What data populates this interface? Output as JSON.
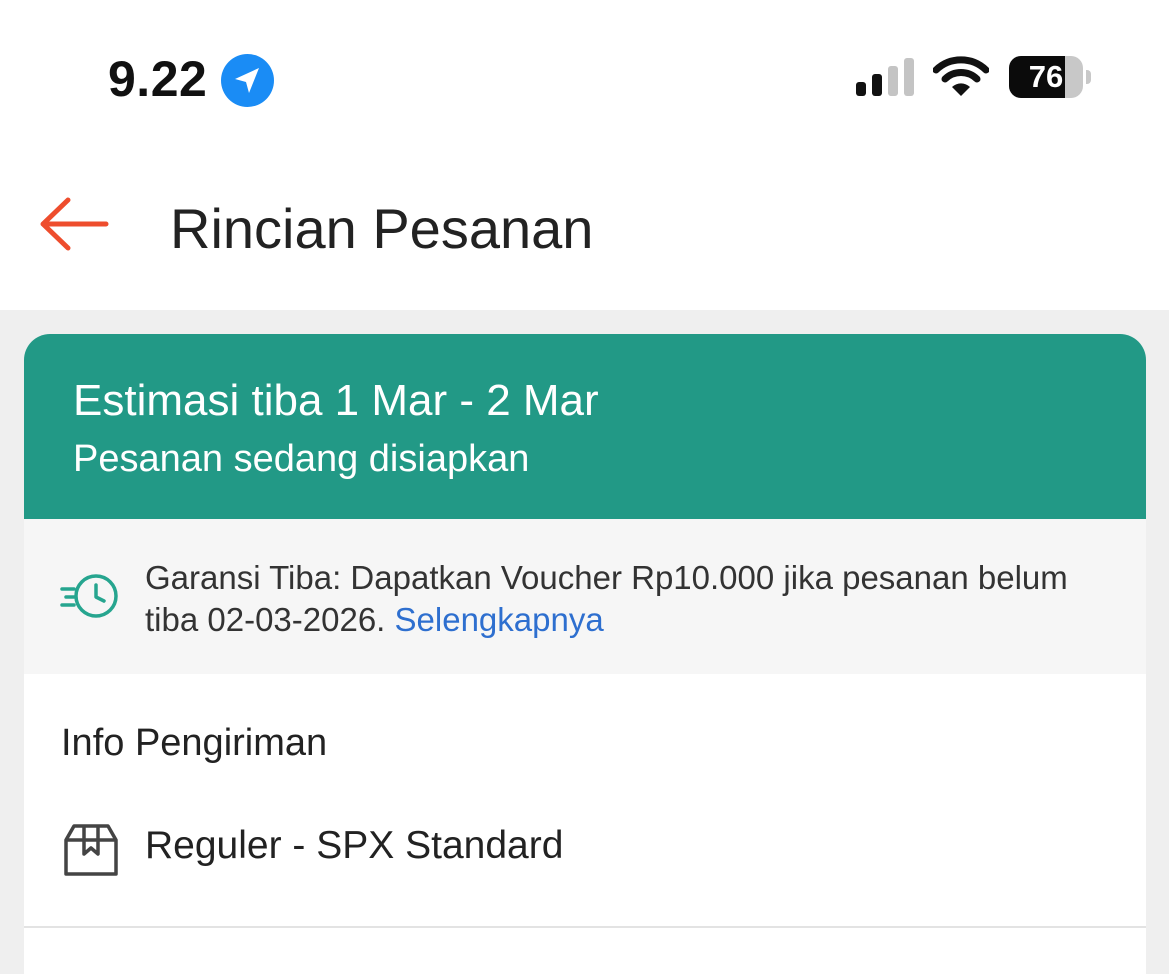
{
  "status_bar": {
    "time": "9.22",
    "location_icon": "location-arrow-icon",
    "signal_icon": "cellular-signal-icon",
    "wifi_icon": "wifi-icon",
    "battery_level": "76",
    "battery_fraction": 0.76
  },
  "header": {
    "back_icon": "arrow-left-icon",
    "title": "Rincian Pesanan"
  },
  "banner": {
    "title": "Estimasi tiba 1 Mar - 2 Mar",
    "subtitle": "Pesanan sedang disiapkan"
  },
  "guarantee": {
    "icon": "fast-clock-icon",
    "text": "Garansi Tiba: Dapatkan Voucher Rp10.000 jika pesanan belum tiba 02-03-2026.",
    "link": "Selengkapnya"
  },
  "shipping_info": {
    "section_title": "Info Pengiriman",
    "icon": "package-box-icon",
    "method": "Reguler - SPX Standard"
  },
  "colors": {
    "accent": "#EE4D2D",
    "banner_bg": "#229986",
    "link": "#2E6FCF",
    "page_bg": "#EFEFEF"
  }
}
